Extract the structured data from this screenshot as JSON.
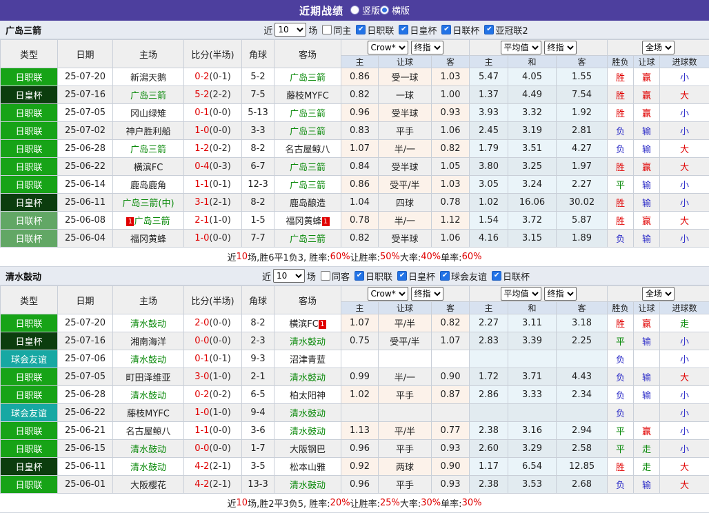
{
  "topbar": {
    "title": "近期战绩",
    "radios": [
      {
        "label": "竖版",
        "checked": false
      },
      {
        "label": "横版",
        "checked": true
      }
    ]
  },
  "columns": {
    "left": [
      "类型",
      "日期",
      "主场",
      "比分(半场)",
      "角球",
      "客场"
    ],
    "sub": [
      "主",
      "让球",
      "客",
      "主",
      "和",
      "客",
      "胜负",
      "让球",
      "进球数"
    ]
  },
  "league_colors": {
    "日职联": "#17a317",
    "日皇杯": "#0c3d0e",
    "日联杯": "#62a765",
    "球会友谊": "#17a8a3"
  },
  "result_colors": {
    "胜": "#e00000",
    "平": "#0a8a0a",
    "负": "#2e2ec8",
    "赢": "#e00000",
    "输": "#2e2ec8",
    "走": "#0a8a0a",
    "大": "#e00000",
    "小": "#2e2ec8"
  },
  "tables": [
    {
      "team": "广岛三箭",
      "filter": {
        "near_label": "近",
        "count": "10",
        "games_label": "场",
        "same_label": "同主",
        "same_checked": false,
        "leagues": [
          "日职联",
          "日皇杯",
          "日联杯",
          "亚冠联2"
        ]
      },
      "selects": {
        "book": "Crow*",
        "book_time": "终指",
        "avg": "平均值",
        "avg_time": "终指",
        "scope": "全场"
      },
      "rows": [
        {
          "type": "日职联",
          "date": "25-07-20",
          "home": "新潟天鹅",
          "home_green": false,
          "home_badge": "",
          "score_ft": "0-2",
          "score_ht": "(0-1)",
          "corner": "5-2",
          "away": "广岛三箭",
          "away_green": true,
          "away_badge": "",
          "odds": [
            "0.86",
            "受一球",
            "1.03"
          ],
          "avg": [
            "5.47",
            "4.05",
            "1.55"
          ],
          "res": [
            "胜",
            "赢",
            "小"
          ]
        },
        {
          "type": "日皇杯",
          "date": "25-07-16",
          "home": "广岛三箭",
          "home_green": true,
          "home_badge": "",
          "score_ft": "5-2",
          "score_ht": "(2-2)",
          "corner": "7-5",
          "away": "藤枝MYFC",
          "away_green": false,
          "away_badge": "",
          "odds": [
            "0.82",
            "一球",
            "1.00"
          ],
          "avg": [
            "1.37",
            "4.49",
            "7.54"
          ],
          "res": [
            "胜",
            "赢",
            "大"
          ]
        },
        {
          "type": "日职联",
          "date": "25-07-05",
          "home": "冈山绿雉",
          "home_green": false,
          "home_badge": "",
          "score_ft": "0-1",
          "score_ht": "(0-0)",
          "corner": "5-13",
          "away": "广岛三箭",
          "away_green": true,
          "away_badge": "",
          "odds": [
            "0.96",
            "受半球",
            "0.93"
          ],
          "avg": [
            "3.93",
            "3.32",
            "1.92"
          ],
          "res": [
            "胜",
            "赢",
            "小"
          ]
        },
        {
          "type": "日职联",
          "date": "25-07-02",
          "home": "神户胜利船",
          "home_green": false,
          "home_badge": "",
          "score_ft": "1-0",
          "score_ht": "(0-0)",
          "corner": "3-3",
          "away": "广岛三箭",
          "away_green": true,
          "away_badge": "",
          "odds": [
            "0.83",
            "平手",
            "1.06"
          ],
          "avg": [
            "2.45",
            "3.19",
            "2.81"
          ],
          "res": [
            "负",
            "输",
            "小"
          ]
        },
        {
          "type": "日职联",
          "date": "25-06-28",
          "home": "广岛三箭",
          "home_green": true,
          "home_badge": "",
          "score_ft": "1-2",
          "score_ht": "(0-2)",
          "corner": "8-2",
          "away": "名古屋鲸八",
          "away_green": false,
          "away_badge": "",
          "odds": [
            "1.07",
            "半/一",
            "0.82"
          ],
          "avg": [
            "1.79",
            "3.51",
            "4.27"
          ],
          "res": [
            "负",
            "输",
            "大"
          ]
        },
        {
          "type": "日职联",
          "date": "25-06-22",
          "home": "横滨FC",
          "home_green": false,
          "home_badge": "",
          "score_ft": "0-4",
          "score_ht": "(0-3)",
          "corner": "6-7",
          "away": "广岛三箭",
          "away_green": true,
          "away_badge": "",
          "odds": [
            "0.84",
            "受半球",
            "1.05"
          ],
          "avg": [
            "3.80",
            "3.25",
            "1.97"
          ],
          "res": [
            "胜",
            "赢",
            "大"
          ]
        },
        {
          "type": "日职联",
          "date": "25-06-14",
          "home": "鹿岛鹿角",
          "home_green": false,
          "home_badge": "",
          "score_ft": "1-1",
          "score_ht": "(0-1)",
          "corner": "12-3",
          "away": "广岛三箭",
          "away_green": true,
          "away_badge": "",
          "odds": [
            "0.86",
            "受平/半",
            "1.03"
          ],
          "avg": [
            "3.05",
            "3.24",
            "2.27"
          ],
          "res": [
            "平",
            "输",
            "小"
          ]
        },
        {
          "type": "日皇杯",
          "date": "25-06-11",
          "home": "广岛三箭(中)",
          "home_green": true,
          "home_badge": "",
          "score_ft": "3-1",
          "score_ht": "(2-1)",
          "corner": "8-2",
          "away": "鹿岛酿造",
          "away_green": false,
          "away_badge": "",
          "odds": [
            "1.04",
            "四球",
            "0.78"
          ],
          "avg": [
            "1.02",
            "16.06",
            "30.02"
          ],
          "res": [
            "胜",
            "输",
            "小"
          ]
        },
        {
          "type": "日联杯",
          "date": "25-06-08",
          "home": "广岛三箭",
          "home_green": true,
          "home_badge": "1",
          "score_ft": "2-1",
          "score_ht": "(1-0)",
          "corner": "1-5",
          "away": "福冈黄蜂",
          "away_green": false,
          "away_badge": "1",
          "odds": [
            "0.78",
            "半/一",
            "1.12"
          ],
          "avg": [
            "1.54",
            "3.72",
            "5.87"
          ],
          "res": [
            "胜",
            "赢",
            "大"
          ]
        },
        {
          "type": "日联杯",
          "date": "25-06-04",
          "home": "福冈黄蜂",
          "home_green": false,
          "home_badge": "",
          "score_ft": "1-0",
          "score_ht": "(0-0)",
          "corner": "7-7",
          "away": "广岛三箭",
          "away_green": true,
          "away_badge": "",
          "odds": [
            "0.82",
            "受半球",
            "1.06"
          ],
          "avg": [
            "4.16",
            "3.15",
            "1.89"
          ],
          "res": [
            "负",
            "输",
            "小"
          ]
        }
      ],
      "summary": [
        {
          "t": "近"
        },
        {
          "t": "10",
          "red": true
        },
        {
          "t": "场,胜6平1负3, 胜率:"
        },
        {
          "t": "60%",
          "red": true
        },
        {
          "t": " 让胜率:"
        },
        {
          "t": "50%",
          "red": true
        },
        {
          "t": " 大率:"
        },
        {
          "t": "40%",
          "red": true
        },
        {
          "t": " 单率:"
        },
        {
          "t": "60%",
          "red": true
        }
      ]
    },
    {
      "team": "清水鼓动",
      "filter": {
        "near_label": "近",
        "count": "10",
        "games_label": "场",
        "same_label": "同客",
        "same_checked": false,
        "leagues": [
          "日职联",
          "日皇杯",
          "球会友谊",
          "日联杯"
        ]
      },
      "selects": {
        "book": "Crow*",
        "book_time": "终指",
        "avg": "平均值",
        "avg_time": "终指",
        "scope": "全场"
      },
      "rows": [
        {
          "type": "日职联",
          "date": "25-07-20",
          "home": "清水鼓动",
          "home_green": true,
          "home_badge": "",
          "score_ft": "2-0",
          "score_ht": "(0-0)",
          "corner": "8-2",
          "away": "横滨FC",
          "away_green": false,
          "away_badge": "1",
          "odds": [
            "1.07",
            "平/半",
            "0.82"
          ],
          "avg": [
            "2.27",
            "3.11",
            "3.18"
          ],
          "res": [
            "胜",
            "赢",
            "走"
          ]
        },
        {
          "type": "日皇杯",
          "date": "25-07-16",
          "home": "湘南海洋",
          "home_green": false,
          "home_badge": "",
          "score_ft": "0-0",
          "score_ht": "(0-0)",
          "corner": "2-3",
          "away": "清水鼓动",
          "away_green": true,
          "away_badge": "",
          "odds": [
            "0.75",
            "受平/半",
            "1.07"
          ],
          "avg": [
            "2.83",
            "3.39",
            "2.25"
          ],
          "res": [
            "平",
            "输",
            "小"
          ]
        },
        {
          "type": "球会友谊",
          "date": "25-07-06",
          "home": "清水鼓动",
          "home_green": true,
          "home_badge": "",
          "score_ft": "0-1",
          "score_ht": "(0-1)",
          "corner": "9-3",
          "away": "沼津青蓝",
          "away_green": false,
          "away_badge": "",
          "odds": [
            "",
            "",
            ""
          ],
          "avg": [
            "",
            "",
            ""
          ],
          "res": [
            "负",
            "",
            "小"
          ]
        },
        {
          "type": "日职联",
          "date": "25-07-05",
          "home": "町田泽维亚",
          "home_green": false,
          "home_badge": "",
          "score_ft": "3-0",
          "score_ht": "(1-0)",
          "corner": "2-1",
          "away": "清水鼓动",
          "away_green": true,
          "away_badge": "",
          "odds": [
            "0.99",
            "半/一",
            "0.90"
          ],
          "avg": [
            "1.72",
            "3.71",
            "4.43"
          ],
          "res": [
            "负",
            "输",
            "大"
          ]
        },
        {
          "type": "日职联",
          "date": "25-06-28",
          "home": "清水鼓动",
          "home_green": true,
          "home_badge": "",
          "score_ft": "0-2",
          "score_ht": "(0-2)",
          "corner": "6-5",
          "away": "柏太阳神",
          "away_green": false,
          "away_badge": "",
          "odds": [
            "1.02",
            "平手",
            "0.87"
          ],
          "avg": [
            "2.86",
            "3.33",
            "2.34"
          ],
          "res": [
            "负",
            "输",
            "小"
          ]
        },
        {
          "type": "球会友谊",
          "date": "25-06-22",
          "home": "藤枝MYFC",
          "home_green": false,
          "home_badge": "",
          "score_ft": "1-0",
          "score_ht": "(1-0)",
          "corner": "9-4",
          "away": "清水鼓动",
          "away_green": true,
          "away_badge": "",
          "odds": [
            "",
            "",
            ""
          ],
          "avg": [
            "",
            "",
            ""
          ],
          "res": [
            "负",
            "",
            "小"
          ]
        },
        {
          "type": "日职联",
          "date": "25-06-21",
          "home": "名古屋鲸八",
          "home_green": false,
          "home_badge": "",
          "score_ft": "1-1",
          "score_ht": "(0-0)",
          "corner": "3-6",
          "away": "清水鼓动",
          "away_green": true,
          "away_badge": "",
          "odds": [
            "1.13",
            "平/半",
            "0.77"
          ],
          "avg": [
            "2.38",
            "3.16",
            "2.94"
          ],
          "res": [
            "平",
            "赢",
            "小"
          ]
        },
        {
          "type": "日职联",
          "date": "25-06-15",
          "home": "清水鼓动",
          "home_green": true,
          "home_badge": "",
          "score_ft": "0-0",
          "score_ht": "(0-0)",
          "corner": "1-7",
          "away": "大阪钢巴",
          "away_green": false,
          "away_badge": "",
          "odds": [
            "0.96",
            "平手",
            "0.93"
          ],
          "avg": [
            "2.60",
            "3.29",
            "2.58"
          ],
          "res": [
            "平",
            "走",
            "小"
          ]
        },
        {
          "type": "日皇杯",
          "date": "25-06-11",
          "home": "清水鼓动",
          "home_green": true,
          "home_badge": "",
          "score_ft": "4-2",
          "score_ht": "(2-1)",
          "corner": "3-5",
          "away": "松本山雅",
          "away_green": false,
          "away_badge": "",
          "odds": [
            "0.92",
            "两球",
            "0.90"
          ],
          "avg": [
            "1.17",
            "6.54",
            "12.85"
          ],
          "res": [
            "胜",
            "走",
            "大"
          ]
        },
        {
          "type": "日职联",
          "date": "25-06-01",
          "home": "大阪樱花",
          "home_green": false,
          "home_badge": "",
          "score_ft": "4-2",
          "score_ht": "(2-1)",
          "corner": "13-3",
          "away": "清水鼓动",
          "away_green": true,
          "away_badge": "",
          "odds": [
            "0.96",
            "平手",
            "0.93"
          ],
          "avg": [
            "2.38",
            "3.53",
            "2.68"
          ],
          "res": [
            "负",
            "输",
            "大"
          ]
        }
      ],
      "summary": [
        {
          "t": "近"
        },
        {
          "t": "10",
          "red": true
        },
        {
          "t": "场,胜2平3负5, 胜率:"
        },
        {
          "t": "20%",
          "red": true
        },
        {
          "t": " 让胜率:"
        },
        {
          "t": "25%",
          "red": true
        },
        {
          "t": " 大率:"
        },
        {
          "t": "30%",
          "red": true
        },
        {
          "t": " 单率:"
        },
        {
          "t": "30%",
          "red": true
        }
      ]
    }
  ]
}
